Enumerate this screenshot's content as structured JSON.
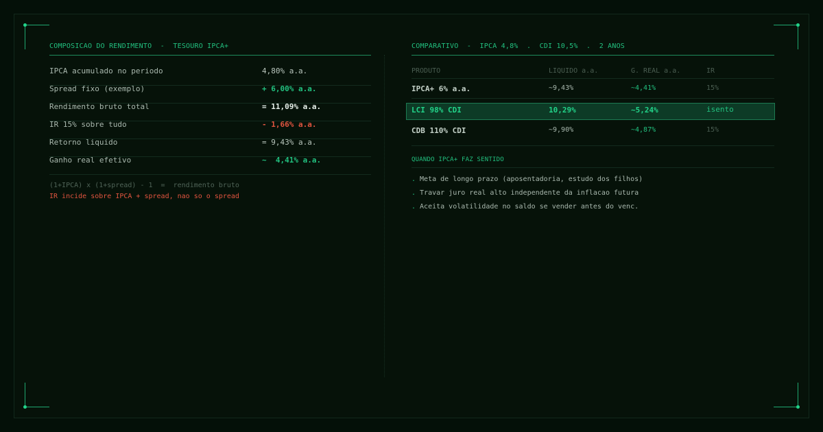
{
  "left": {
    "title": "COMPOSICAO DO RENDIMENTO  -  TESOURO IPCA+",
    "rows": [
      {
        "label": "IPCA acumulado no periodo",
        "value": "4,80% a.a."
      },
      {
        "label": "Spread fixo (exemplo)",
        "value": "+ 6,00% a.a."
      },
      {
        "label": "Rendimento bruto total",
        "value": "= 11,09% a.a."
      },
      {
        "label": "IR 15% sobre tudo",
        "value": "- 1,66% a.a."
      },
      {
        "label": "Retorno liquido",
        "value": "= 9,43% a.a."
      },
      {
        "label": "Ganho real efetivo",
        "value": "~  4,41% a.a."
      }
    ],
    "formula": "(1+IPCA) x (1+spread) - 1  =  rendimento bruto",
    "warning": "IR incide sobre IPCA + spread, nao so o spread"
  },
  "right": {
    "title": "COMPARATIVO  -  IPCA 4,8%  .  CDI 10,5%  .  2 ANOS",
    "columns": [
      "PRODUTO",
      "LIQUIDO a.a.",
      "G. REAL a.a.",
      "IR"
    ],
    "rows": [
      {
        "produto": "IPCA+ 6% a.a.",
        "liquido": "~9,43%",
        "real": "~4,41%",
        "ir": "15%"
      },
      {
        "produto": "LCI 98% CDI",
        "liquido": "10,29%",
        "real": "~5,24%",
        "ir": "isento"
      },
      {
        "produto": "CDB 110% CDI",
        "liquido": "~9,90%",
        "real": "~4,87%",
        "ir": "15%"
      }
    ],
    "when_title": "QUANDO IPCA+ FAZ SENTIDO",
    "bullets": [
      "Meta de longo prazo (aposentadoria, estudo dos filhos)",
      "Travar juro real alto independente da inflacao futura",
      "Aceita volatilidade no saldo se vender antes do venc."
    ]
  },
  "colors": {
    "background": "#041008",
    "accent": "#22c07f",
    "negative": "#e0543f",
    "highlight_row": "#0d3b26"
  }
}
